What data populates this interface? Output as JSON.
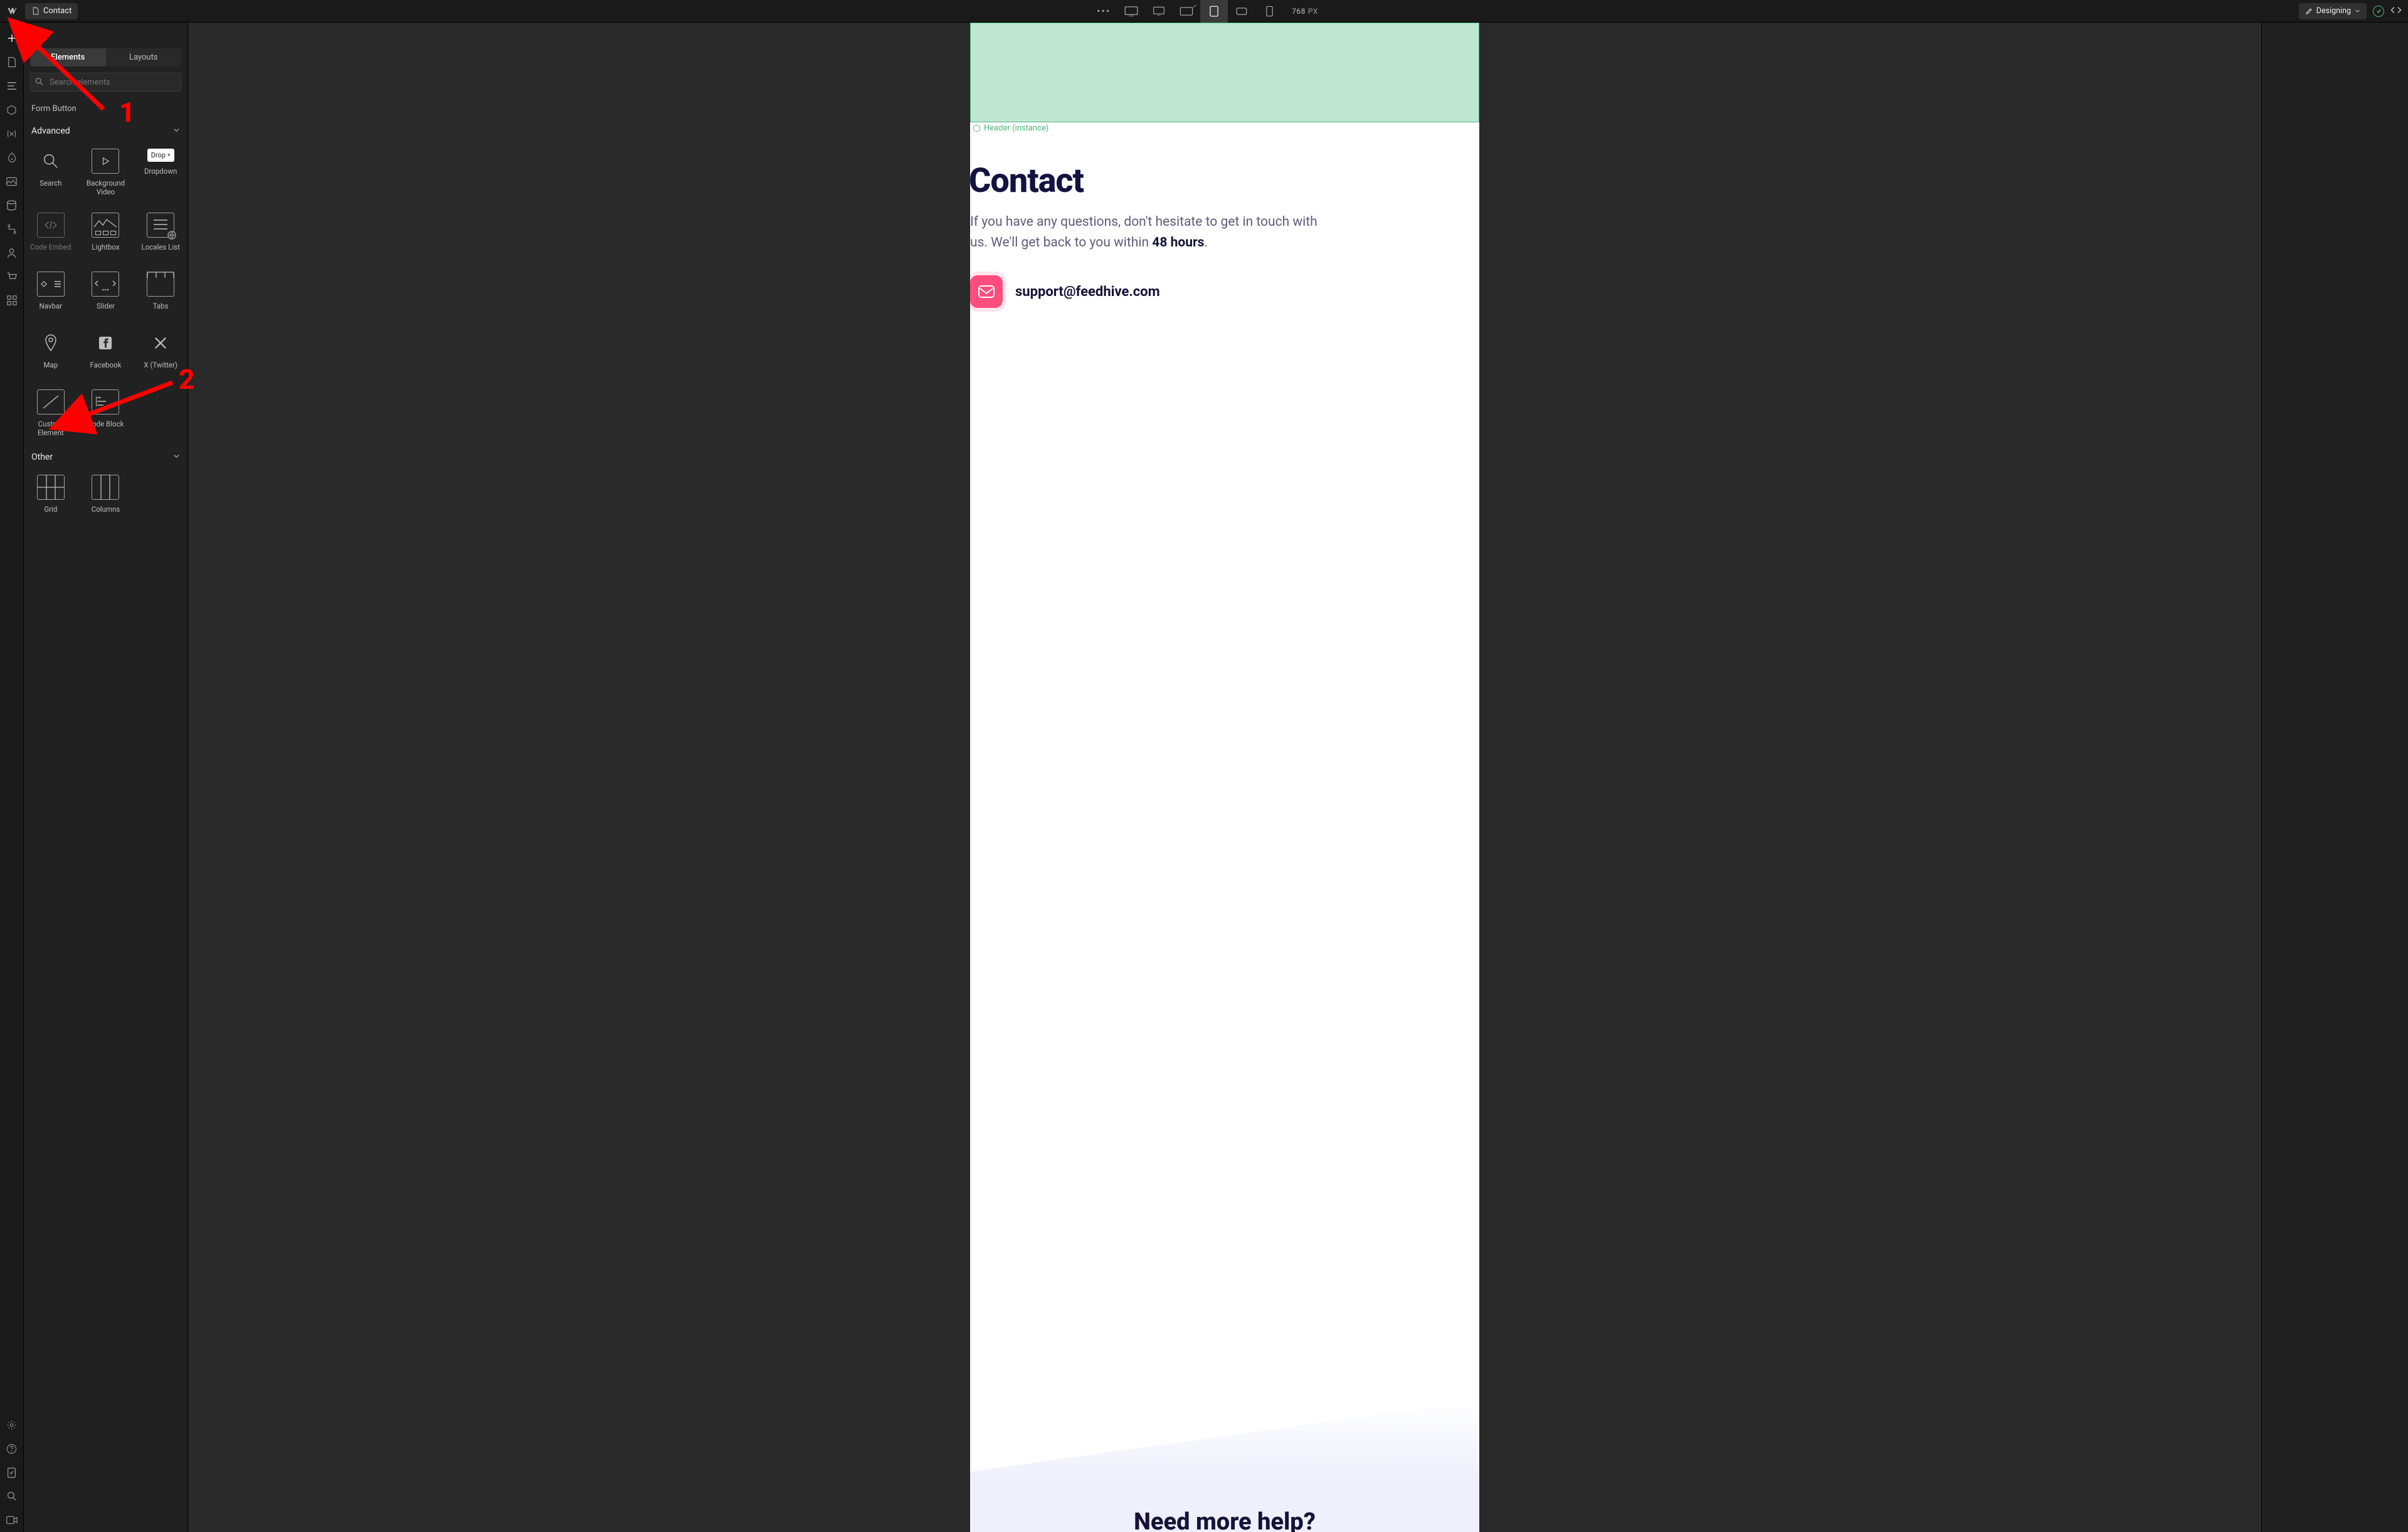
{
  "topbar": {
    "page_label": "Contact",
    "designing_label": "Designing",
    "width_value": "768",
    "width_unit": "PX"
  },
  "panel": {
    "title": "Add",
    "tabs": {
      "elements": "Elements",
      "layouts": "Layouts"
    },
    "search_placeholder": "Search elements",
    "form_button": "Form Button",
    "cat_advanced": "Advanced",
    "cat_other": "Other",
    "tiles": {
      "search": "Search",
      "bgvideo": "Background Video",
      "dropdown": "Dropdown",
      "drop_chip": "Drop",
      "code_embed": "Code Embed",
      "lightbox": "Lightbox",
      "locales": "Locales List",
      "navbar": "Navbar",
      "slider": "Slider",
      "tabs": "Tabs",
      "map": "Map",
      "facebook": "Facebook",
      "twitter": "X (Twitter)",
      "custom_el": "Custom Element",
      "code_block": "Code Block",
      "grid": "Grid",
      "columns": "Columns"
    }
  },
  "canvas": {
    "selection_label": "Header (instance)",
    "h1": "Contact",
    "p_text": "If you have any questions, don't hesitate to get in touch with us. We'll get back to you within ",
    "p_bold": "48 hours",
    "email": "support@feedhive.com",
    "help_h2": "Need more help?"
  },
  "annotations": {
    "n1": "1",
    "n2": "2"
  }
}
